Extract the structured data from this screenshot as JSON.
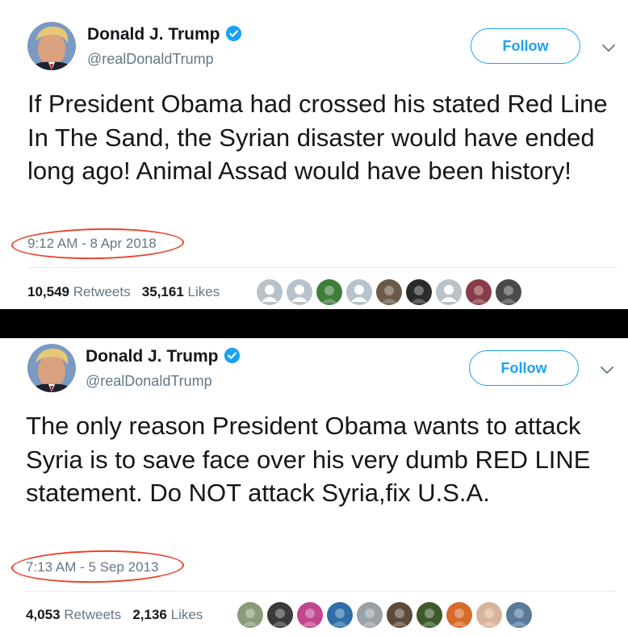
{
  "tweets": [
    {
      "name": "Donald J. Trump",
      "handle": "@realDonaldTrump",
      "follow_label": "Follow",
      "text": "If President Obama had crossed his stated Red Line In The Sand, the Syrian disaster would have ended long ago! Animal Assad would have been history!",
      "timestamp": "9:12 AM - 8 Apr 2018",
      "retweets_count": "10,549",
      "retweets_label": "Retweets",
      "likes_count": "35,161",
      "likes_label": "Likes",
      "likers": [
        {
          "icon": "default-avatar-icon",
          "color": "#b8c2ca"
        },
        {
          "icon": "default-avatar-icon",
          "color": "#b8c2ca"
        },
        {
          "icon": "user-avatar",
          "color": "#3e7d3a"
        },
        {
          "icon": "default-avatar-icon",
          "color": "#b8c2ca"
        },
        {
          "icon": "user-avatar",
          "color": "#6b5a4a"
        },
        {
          "icon": "user-avatar",
          "color": "#2b2b2b"
        },
        {
          "icon": "default-avatar-icon",
          "color": "#b8c2ca"
        },
        {
          "icon": "user-avatar",
          "color": "#8a3b4a"
        },
        {
          "icon": "user-avatar",
          "color": "#4a4a4a"
        }
      ]
    },
    {
      "name": "Donald J. Trump",
      "handle": "@realDonaldTrump",
      "follow_label": "Follow",
      "text": "The only reason President Obama wants to attack Syria is to save face over his very dumb RED LINE statement. Do NOT attack Syria,fix U.S.A.",
      "timestamp": "7:13 AM - 5 Sep 2013",
      "retweets_count": "4,053",
      "retweets_label": "Retweets",
      "likes_count": "2,136",
      "likes_label": "Likes",
      "likers": [
        {
          "icon": "user-avatar",
          "color": "#8a9a7a"
        },
        {
          "icon": "user-avatar",
          "color": "#3a3a3a"
        },
        {
          "icon": "user-avatar",
          "color": "#c0468e"
        },
        {
          "icon": "user-avatar",
          "color": "#2f6ea8"
        },
        {
          "icon": "user-avatar",
          "color": "#9aa0a6"
        },
        {
          "icon": "user-avatar",
          "color": "#5c4a3a"
        },
        {
          "icon": "user-avatar",
          "color": "#3d5a2a"
        },
        {
          "icon": "user-avatar",
          "color": "#d66b2a"
        },
        {
          "icon": "user-avatar",
          "color": "#d8b59a"
        },
        {
          "icon": "user-avatar",
          "color": "#5a7a9a"
        }
      ]
    }
  ],
  "colors": {
    "brand": "#1da1f2",
    "text": "#14171a",
    "secondary": "#657786",
    "annotation": "#e8452e",
    "separator": "#000000"
  }
}
